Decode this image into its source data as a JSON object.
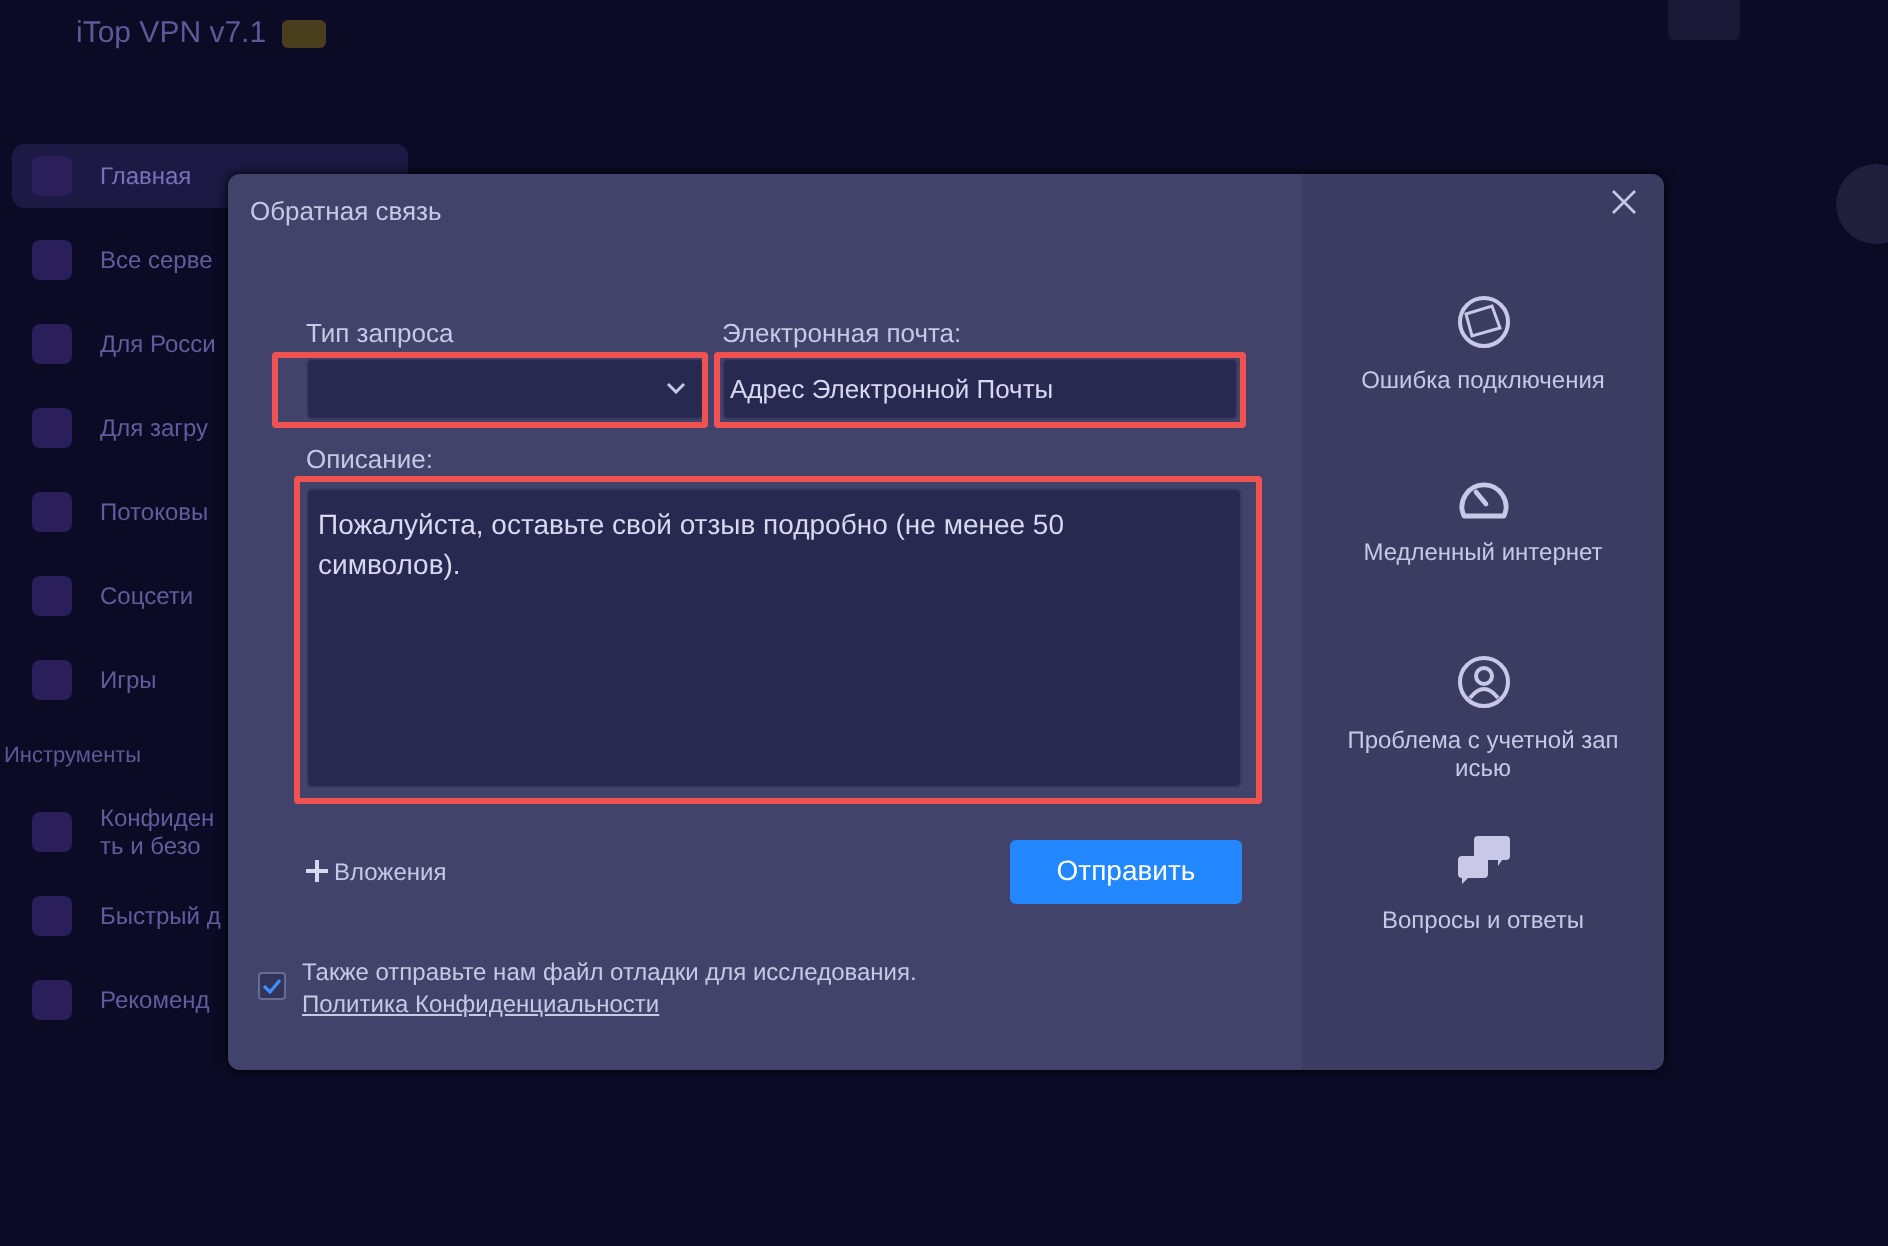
{
  "app": {
    "title": "iTop VPN v7.1"
  },
  "sidebar": {
    "items": [
      {
        "label": "Главная",
        "selected": true
      },
      {
        "label": "Все серве",
        "selected": false
      },
      {
        "label": "Для Росси",
        "selected": false
      },
      {
        "label": "Для загру",
        "selected": false
      },
      {
        "label": "Потоковы",
        "selected": false
      },
      {
        "label": "Соцсети",
        "selected": false
      },
      {
        "label": "Игры",
        "selected": false
      }
    ],
    "section": "Инструменты",
    "tools": [
      {
        "label": "Конфиден\nть и безо"
      },
      {
        "label": "Быстрый д"
      },
      {
        "label": "Рекоменд"
      }
    ]
  },
  "dialog": {
    "title": "Обратная связь",
    "request_type": {
      "label": "Тип запроса"
    },
    "email": {
      "label": "Электронная почта:",
      "placeholder": "Адрес Электронной Почты"
    },
    "description": {
      "label": "Описание:",
      "placeholder": "Пожалуйста, оставьте свой отзыв подробно (не менее 50 символов)."
    },
    "attach": "Вложения",
    "submit": "Отправить",
    "debug": {
      "checked": true,
      "text": "Также отправьте нам файл отладки для исследования.",
      "link": "Политика Конфиденциальности"
    },
    "topics": [
      {
        "kind": "globe",
        "label": "Ошибка подключения"
      },
      {
        "kind": "gauge",
        "label": "Медленный интернет"
      },
      {
        "kind": "user",
        "label": "Проблема с учетной зап исью"
      },
      {
        "kind": "qa",
        "label": "Вопросы и ответы"
      }
    ]
  }
}
